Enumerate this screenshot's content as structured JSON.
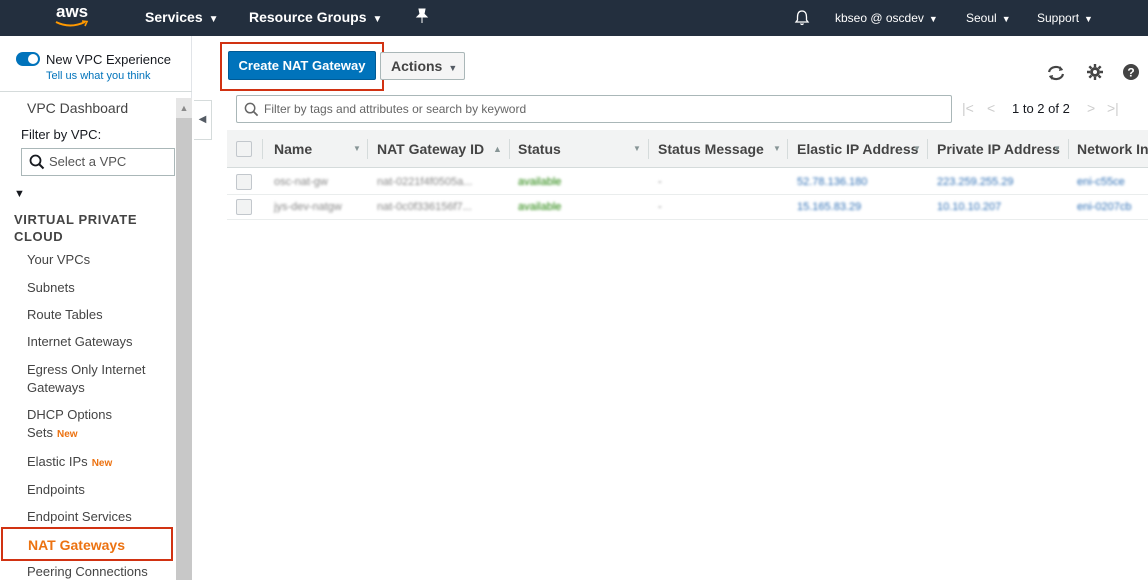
{
  "topnav": {
    "logo": "aws",
    "services": "Services",
    "resource_groups": "Resource Groups",
    "user": "kbseo @ oscdev",
    "region": "Seoul",
    "support": "Support",
    "icons": [
      "pin-icon",
      "bell-icon"
    ]
  },
  "sidebar": {
    "experience_title": "New VPC Experience",
    "experience_link": "Tell us what you think",
    "dashboard": "VPC Dashboard",
    "filter_label": "Filter by VPC:",
    "filter_placeholder": "Select a VPC",
    "section_title": "VIRTUAL PRIVATE CLOUD",
    "items": [
      {
        "label": "Your VPCs"
      },
      {
        "label": "Subnets"
      },
      {
        "label": "Route Tables"
      },
      {
        "label": "Internet Gateways"
      },
      {
        "label": "Egress Only Internet Gateways"
      },
      {
        "label": "DHCP Options Sets",
        "badge": "New"
      },
      {
        "label": "Elastic IPs",
        "badge": "New"
      },
      {
        "label": "Endpoints"
      },
      {
        "label": "Endpoint Services"
      },
      {
        "label": "NAT Gateways",
        "active": true
      },
      {
        "label": "Peering Connections"
      }
    ],
    "egress_line1": "Egress Only Internet",
    "egress_line2": "Gateways",
    "dhcp_line1": "DHCP Options",
    "dhcp_line2": "Sets",
    "badge_new": "New"
  },
  "toolbar": {
    "create_label": "Create NAT Gateway",
    "actions_label": "Actions",
    "filter_placeholder": "Filter by tags and attributes or search by keyword",
    "pagination": "1 to 2 of 2"
  },
  "table": {
    "columns": [
      "Name",
      "NAT Gateway ID",
      "Status",
      "Status Message",
      "Elastic IP Address",
      "Private IP Address",
      "Network In"
    ],
    "rows": [
      {
        "name": "osc-nat-gw",
        "id": "nat-0221f4f0505a...",
        "status": "available",
        "message": "-",
        "elastic_ip": "52.78.136.180",
        "private_ip": "223.259.255.29",
        "network": "eni-c55ce"
      },
      {
        "name": "jys-dev-natgw",
        "id": "nat-0c0f336156f7...",
        "status": "available",
        "message": "-",
        "elastic_ip": "15.165.83.29",
        "private_ip": "10.10.10.207",
        "network": "eni-0207cb"
      }
    ]
  },
  "colors": {
    "nav_bg": "#232f3e",
    "primary": "#0073bb",
    "accent": "#ec7211",
    "highlight": "#d13212"
  }
}
